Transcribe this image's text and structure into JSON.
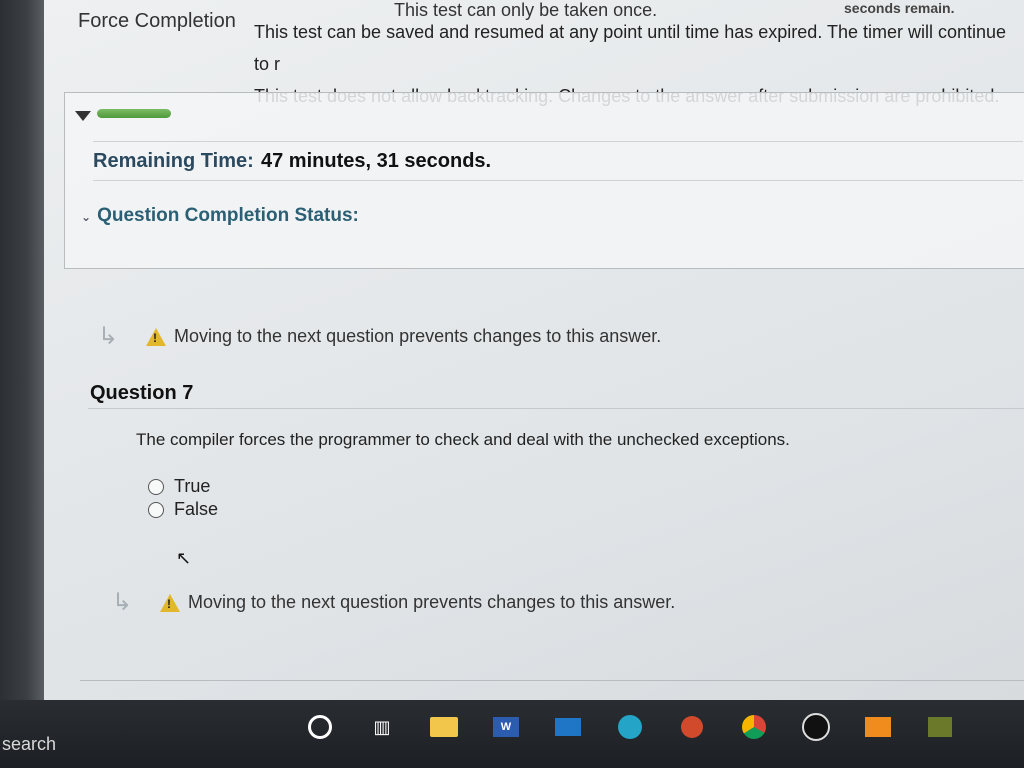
{
  "top": {
    "partial_line": "This test can only be taken once.",
    "partial_right": "seconds remain."
  },
  "force_completion": {
    "label": "Force Completion",
    "line1": "This test can be saved and resumed at any point until time has expired. The timer will continue to r",
    "line2": "This test does not allow backtracking. Changes to the answer after submission are prohibited."
  },
  "status": {
    "remaining_label": "Remaining Time:",
    "remaining_value": "47 minutes, 31 seconds.",
    "question_completion": "Question Completion Status:"
  },
  "warning_text": "Moving to the next question prevents changes to this answer.",
  "question": {
    "title": "Question 7",
    "text": "The compiler forces the programmer to check and deal with the unchecked exceptions.",
    "options": [
      "True",
      "False"
    ]
  },
  "taskbar": {
    "search_text": "search",
    "icons": [
      "cortana-icon",
      "task-view-icon",
      "file-explorer-icon",
      "word-icon",
      "mail-icon",
      "edge-icon",
      "powerpoint-icon",
      "chrome-icon",
      "app-icon",
      "teams-icon",
      "pen-icon"
    ]
  }
}
